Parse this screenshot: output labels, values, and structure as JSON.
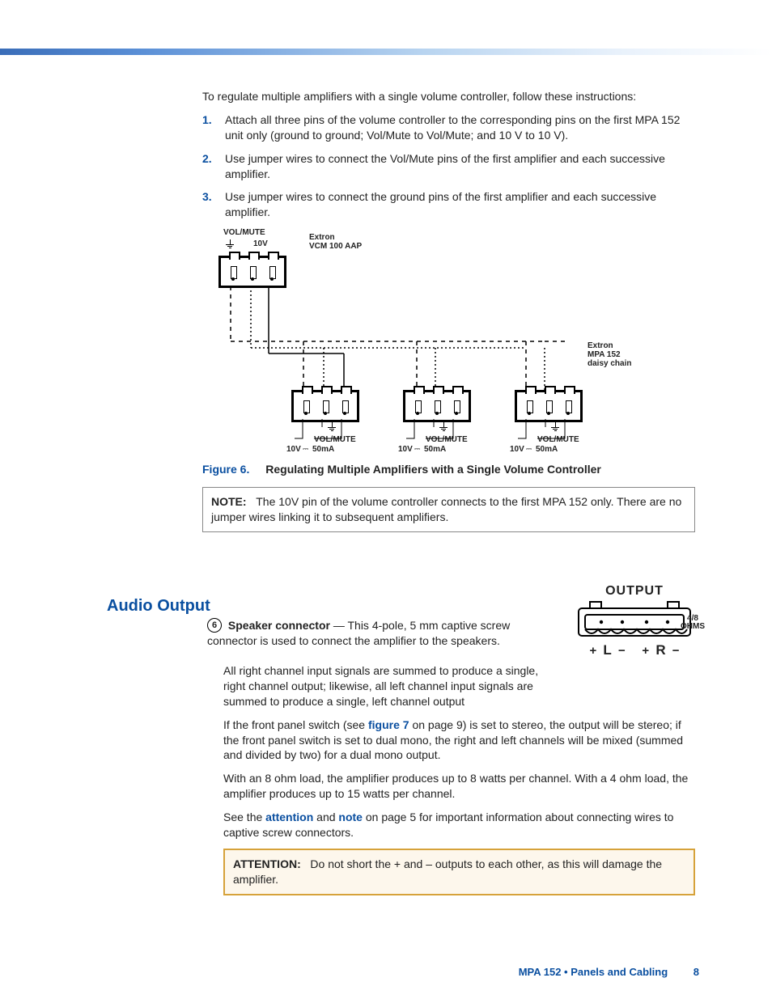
{
  "intro": "To regulate multiple amplifiers with a single volume controller, follow these instructions:",
  "steps": [
    {
      "n": "1.",
      "t": "Attach all three pins of the volume controller to the corresponding pins on the first MPA 152 unit only (ground to ground; Vol/Mute to Vol/Mute; and 10 V to 10 V)."
    },
    {
      "n": "2.",
      "t": "Use jumper wires to connect the Vol/Mute pins of the first amplifier and each successive amplifier."
    },
    {
      "n": "3.",
      "t": "Use jumper wires to connect the ground pins of the first amplifier and each successive amplifier."
    }
  ],
  "diag": {
    "top_vol": "VOL/MUTE",
    "top_10v": "10V",
    "vcm": "Extron\nVCM 100 AAP",
    "daisy": "Extron\nMPA 152\ndaisy chain",
    "bot_vol": "VOL/MUTE",
    "bot_10v": "10V",
    "bot_50": "50mA"
  },
  "fig": {
    "label": "Figure 6.",
    "caption": "Regulating Multiple Amplifiers with a Single Volume Controller"
  },
  "note": {
    "label": "NOTE:",
    "text": "The 10V pin of the volume controller connects to the first MPA 152 only. There are no jumper wires linking it to subsequent amplifiers."
  },
  "h2": "Audio Output",
  "spk": {
    "num": "6",
    "bold": "Speaker connector",
    "rest": " — This 4-pole, 5 mm captive screw connector is used to connect the amplifier to the speakers."
  },
  "p_sum": "All right channel input signals are summed to produce a single, right channel output; likewise, all left channel input signals are summed to produce a single, left channel output",
  "p_fp": {
    "a": "If the front panel switch (see ",
    "link": "figure 7",
    "b": " on page 9) is set to stereo, the output will be stereo; if the front panel switch is set to dual mono, the right and left channels will be mixed (summed and divided by two) for a dual mono output."
  },
  "p_load": "With an 8 ohm load, the amplifier produces up to 8 watts per channel. With a 4 ohm load, the amplifier produces up to 15 watts per channel.",
  "p_see": {
    "a": "See the ",
    "l1": "attention",
    "b": " and ",
    "l2": "note",
    "c": " on page 5 for important information about connecting wires to captive screw connectors."
  },
  "attn": {
    "label": "ATTENTION:",
    "text": "Do not short the + and – outputs to each other, as this will damage the amplifier."
  },
  "inset": {
    "title": "OUTPUT",
    "ohms1": "4/8",
    "ohms2": "OHMS",
    "L": "L",
    "R": "R",
    "plus": "+",
    "minus": "−"
  },
  "footer": {
    "title": "MPA 152 • Panels and Cabling",
    "page": "8"
  }
}
